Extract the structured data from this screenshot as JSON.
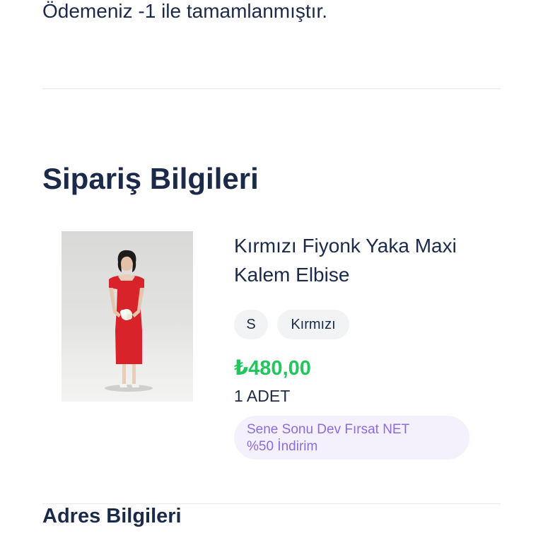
{
  "payment": {
    "message": "Ödemeniz -1 ile tamamlanmıştır."
  },
  "order": {
    "title": "Sipariş Bilgileri",
    "item": {
      "name_line1": "Kırmızı Fiyonk Yaka Maxi",
      "name_line2": "Kalem Elbise",
      "image_alt": "red-dress-photo",
      "size": "S",
      "color": "Kırmızı",
      "price": "₺480,00",
      "quantity": "1 ADET",
      "campaign_line1": "Sene Sonu Dev Fırsat NET",
      "campaign_line2": "%50 İndirim"
    }
  },
  "address": {
    "title": "Adres Bilgileri"
  },
  "colors": {
    "text": "#1c2a4a",
    "price": "#22c55e",
    "campaign_text": "#8b6cdc",
    "campaign_bg": "#f4f1fd",
    "chip_bg": "#f2f3f5",
    "dress": "#d8232a"
  }
}
